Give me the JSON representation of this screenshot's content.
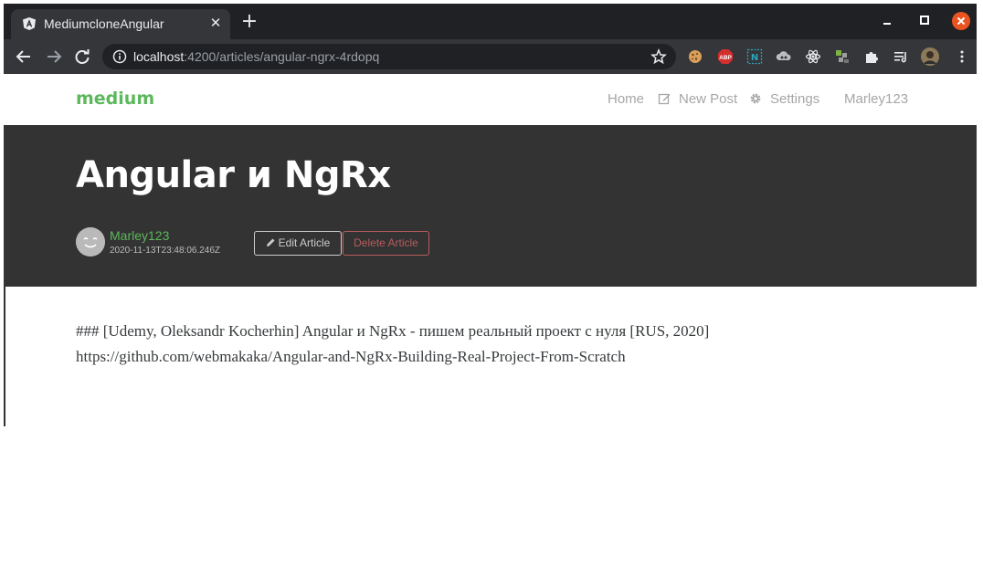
{
  "browser": {
    "tab_title": "MediumcloneAngular",
    "tab_close": "✕",
    "new_tab": "+",
    "url_host": "localhost",
    "url_rest": ":4200/articles/angular-ngrx-4rdopq",
    "extensions": [
      "cookie-icon",
      "adblock-icon",
      "notion-icon",
      "cloud-icon",
      "react-devtools-icon",
      "redux-icon",
      "puzzle-icon",
      "media-queue-icon",
      "profile-avatar-icon"
    ],
    "adblock_label": "ABP",
    "notion_label": "N"
  },
  "navbar": {
    "brand": "medium",
    "links": {
      "home": "Home",
      "new_post": "New Post",
      "settings": "Settings",
      "user": "Marley123"
    }
  },
  "article": {
    "title": "Angular и NgRx",
    "author": "Marley123",
    "date": "2020-11-13T23:48:06.246Z",
    "edit_label": "Edit Article",
    "delete_label": "Delete Article",
    "body_lines": [
      "### [Udemy, Oleksandr Kocherhin] Angular и NgRx - пишем реальный проект с нуля [RUS, 2020]",
      "https://github.com/webmakaka/Angular-and-NgRx-Building-Real-Project-From-Scratch"
    ]
  },
  "colors": {
    "brand_green": "#5cb85c",
    "banner_bg": "#333333",
    "danger": "#b85c5c",
    "chrome_dark": "#202124",
    "chrome_toolbar": "#35363a"
  }
}
